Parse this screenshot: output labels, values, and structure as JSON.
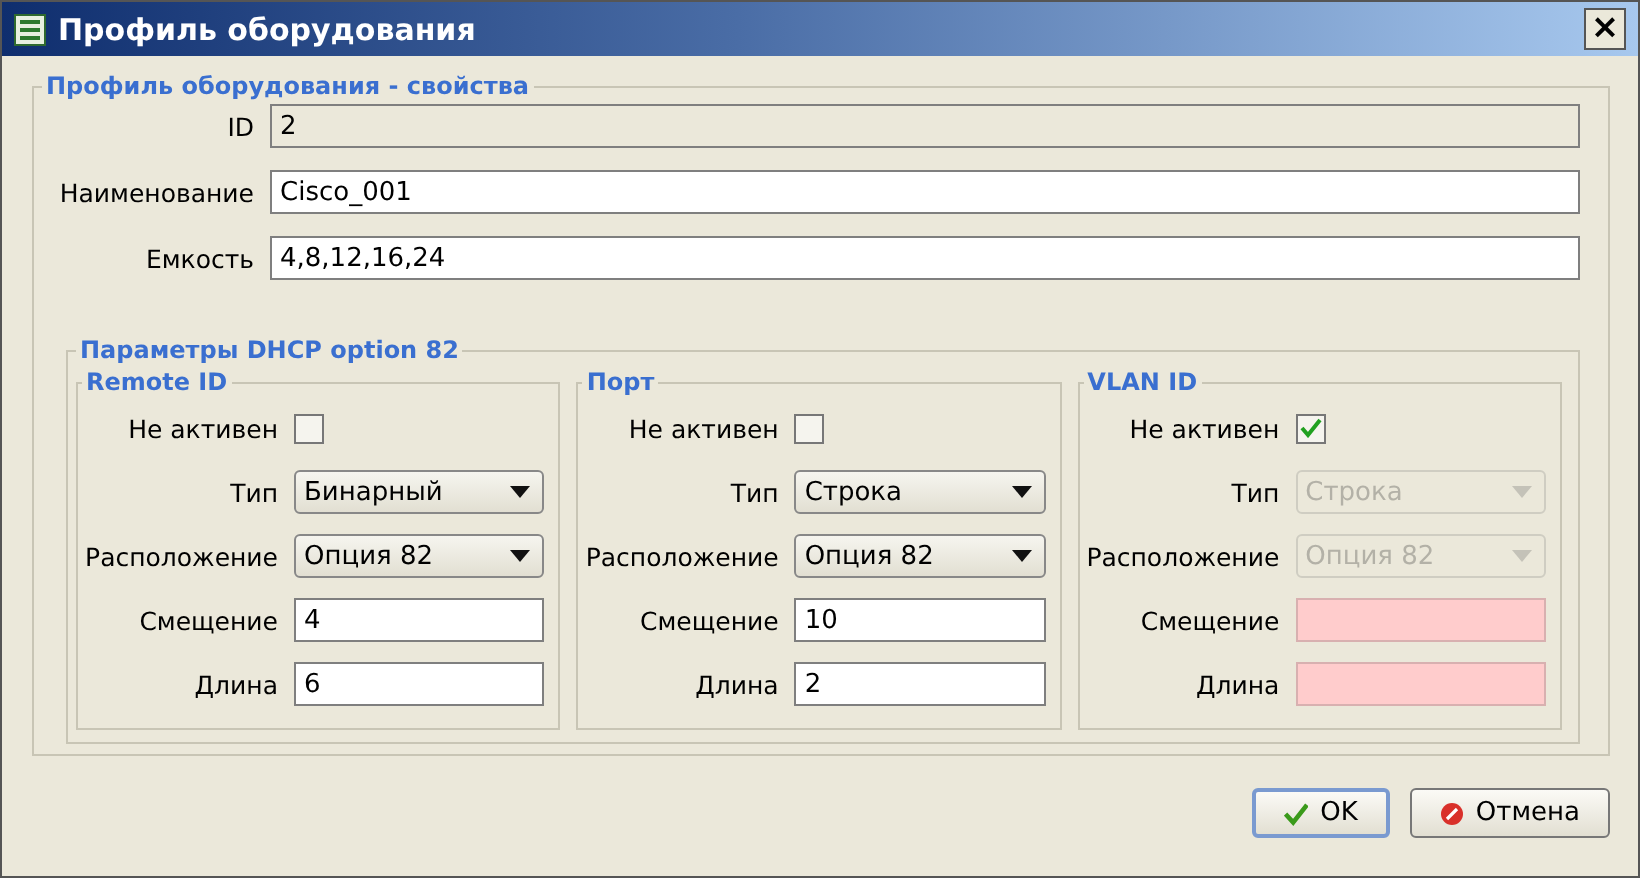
{
  "window": {
    "title": "Профиль оборудования",
    "close": "×"
  },
  "properties": {
    "title": "Профиль оборудования - свойства",
    "fields": [
      {
        "label": "ID",
        "value": "2",
        "disabled": true
      },
      {
        "label": "Наименование",
        "value": "Cisco_001",
        "disabled": false
      },
      {
        "label": "Емкость",
        "value": "4,8,12,16,24",
        "disabled": false
      }
    ]
  },
  "dhcp": {
    "title": "Параметры DHCP option 82",
    "groups": [
      {
        "title": "Remote ID",
        "rows": [
          {
            "kind": "checkbox",
            "label": "Не активен",
            "checked": false
          },
          {
            "kind": "select",
            "label": "Тип",
            "value": "Бинарный",
            "disabled": false
          },
          {
            "kind": "select",
            "label": "Расположение",
            "value": "Опция 82",
            "disabled": false
          },
          {
            "kind": "input",
            "label": "Смещение",
            "value": "4",
            "invalid": false
          },
          {
            "kind": "input",
            "label": "Длина",
            "value": "6",
            "invalid": false
          }
        ]
      },
      {
        "title": "Порт",
        "rows": [
          {
            "kind": "checkbox",
            "label": "Не активен",
            "checked": false
          },
          {
            "kind": "select",
            "label": "Тип",
            "value": "Строка",
            "disabled": false
          },
          {
            "kind": "select",
            "label": "Расположение",
            "value": "Опция 82",
            "disabled": false
          },
          {
            "kind": "input",
            "label": "Смещение",
            "value": "10",
            "invalid": false
          },
          {
            "kind": "input",
            "label": "Длина",
            "value": "2",
            "invalid": false
          }
        ]
      },
      {
        "title": "VLAN ID",
        "rows": [
          {
            "kind": "checkbox",
            "label": "Не активен",
            "checked": true
          },
          {
            "kind": "select",
            "label": "Тип",
            "value": "Строка",
            "disabled": true
          },
          {
            "kind": "select",
            "label": "Расположение",
            "value": "Опция 82",
            "disabled": true
          },
          {
            "kind": "input",
            "label": "Смещение",
            "invalid": true
          },
          {
            "kind": "input",
            "label": "Длина",
            "invalid": true
          }
        ]
      }
    ]
  },
  "buttons": [
    {
      "kind": "ok",
      "label": "OK",
      "selected": true
    },
    {
      "kind": "cancel",
      "label": "Отмена",
      "selected": false
    }
  ]
}
